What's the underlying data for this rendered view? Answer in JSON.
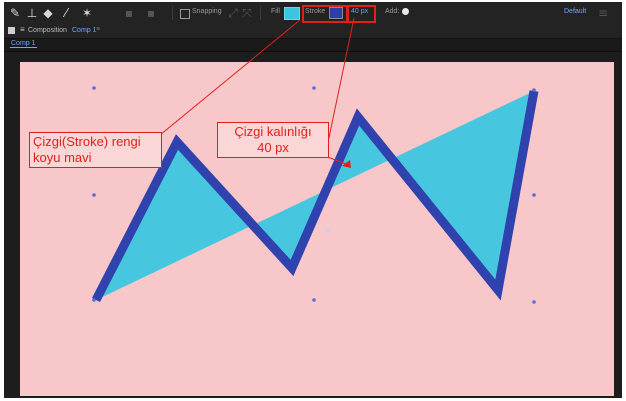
{
  "toolbar": {
    "tools": [
      {
        "icon": "brush-icon",
        "glyph": "✎"
      },
      {
        "icon": "stamp-icon",
        "glyph": "⊥"
      },
      {
        "icon": "eraser-icon",
        "glyph": "◆"
      },
      {
        "icon": "roto-brush-icon",
        "glyph": "⁄"
      },
      {
        "icon": "puppet-pin-icon",
        "glyph": "✶"
      }
    ],
    "snapping_label": "Snapping",
    "fill_label": "Fill",
    "stroke_label": "Stroke",
    "stroke_width": "40 px",
    "add_label": "Add:",
    "workspace_label": "Default",
    "fill_color": "#39c6e0",
    "stroke_color": "#2f3fa8"
  },
  "panel": {
    "label": "Composition",
    "comp_name": "Comp 1",
    "tab": "Comp 1"
  },
  "annotations": {
    "stroke_color_note": "Çizgi(Stroke) rengi\nkoyu mavi",
    "stroke_width_note": "Çizgi kalınlığı\n40 px"
  },
  "colors": {
    "canvas_bg": "#f7c7c9",
    "shape_fill": "#46c7df",
    "shape_stroke": "#2f42ad",
    "highlight": "#e0201c"
  }
}
